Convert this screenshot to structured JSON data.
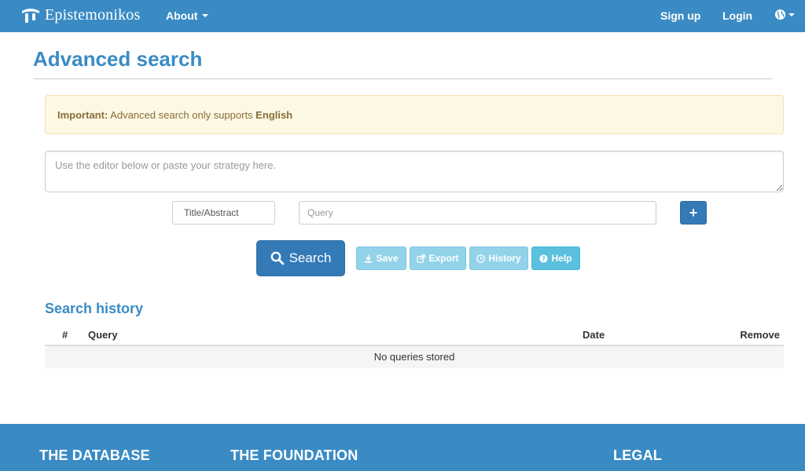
{
  "navbar": {
    "brand": "Epistemonikos",
    "about_label": "About",
    "signup_label": "Sign up",
    "login_label": "Login",
    "language_icon": "globe-icon"
  },
  "page": {
    "title": "Advanced search"
  },
  "alert": {
    "strong": "Important:",
    "text": " Advanced search only supports ",
    "language": "English"
  },
  "strategy": {
    "placeholder": "Use the editor below or paste your strategy here."
  },
  "query_row": {
    "field_value": "Title/Abstract",
    "query_placeholder": "Query",
    "add_label": "+"
  },
  "actions": {
    "search_label": "Search",
    "save_label": "Save",
    "export_label": "Export",
    "history_label": "History",
    "help_label": "Help"
  },
  "history": {
    "title": "Search history",
    "columns": [
      "#",
      "Query",
      "Date",
      "Remove"
    ],
    "empty_message": "No queries stored"
  },
  "footer": {
    "headings": [
      "THE DATABASE",
      "THE FOUNDATION",
      "LEGAL"
    ]
  },
  "colors": {
    "brand": "#3a8bc4",
    "primary": "#337ab7",
    "info_light": "#93d3ea",
    "info": "#5bc0de",
    "warning_bg": "#fcf8e3",
    "warning_text": "#8a6d3b"
  }
}
